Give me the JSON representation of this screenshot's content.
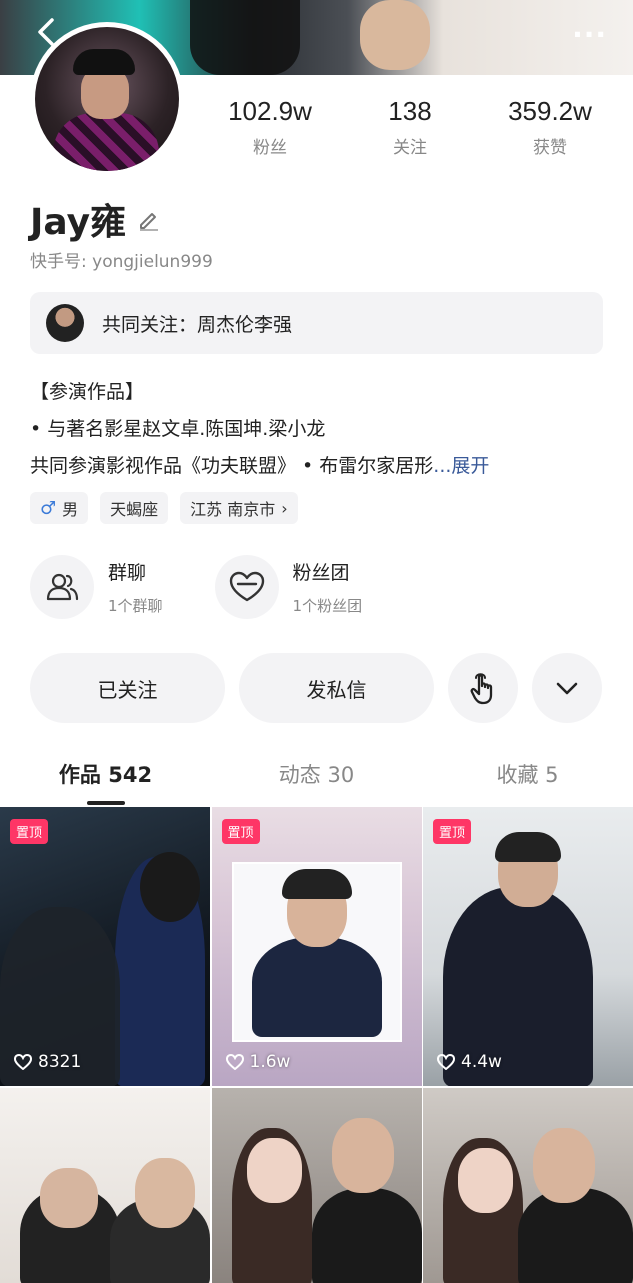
{
  "profile": {
    "name": "Jay雍",
    "kwai_id": "快手号: yongjielun999",
    "stats": [
      {
        "value": "102.9w",
        "label": "粉丝"
      },
      {
        "value": "138",
        "label": "关注"
      },
      {
        "value": "359.2w",
        "label": "获赞"
      }
    ],
    "common_follow": "共同关注：周杰伦李强",
    "bio": {
      "line1": "【参演作品】",
      "line2": "•  与著名影星赵文卓.陈国坤.梁小龙",
      "line3": "共同参演影视作品《功夫联盟》 •  布雷尔家居形",
      "expand": "...展开"
    },
    "tags": {
      "gender_symbol": "♂",
      "gender": "男",
      "zodiac": "天蝎座",
      "location": "江苏 南京市",
      "location_chevron": "›"
    }
  },
  "groups": [
    {
      "title": "群聊",
      "subtitle": "1个群聊",
      "icon": "group-chat-icon"
    },
    {
      "title": "粉丝团",
      "subtitle": "1个粉丝团",
      "icon": "fan-club-icon"
    }
  ],
  "actions": {
    "followed": "已关注",
    "message": "发私信",
    "tap_icon": "tap-hand-icon",
    "more_icon": "chevron-down-icon"
  },
  "tabs": [
    {
      "label": "作品 542",
      "active": true
    },
    {
      "label": "动态 30",
      "active": false
    },
    {
      "label": "收藏 5",
      "active": false
    }
  ],
  "videos": [
    {
      "pinned": "置顶",
      "likes": "8321"
    },
    {
      "pinned": "置顶",
      "likes": "1.6w"
    },
    {
      "pinned": "置顶",
      "likes": "4.4w"
    },
    {
      "pinned": "",
      "likes": ""
    },
    {
      "pinned": "",
      "likes": ""
    },
    {
      "pinned": "",
      "likes": ""
    }
  ],
  "header": {
    "more": "···"
  },
  "colors": {
    "accent_pin": "#fe3666",
    "expand_link": "#3a5a99",
    "male": "#3c7bd8"
  }
}
